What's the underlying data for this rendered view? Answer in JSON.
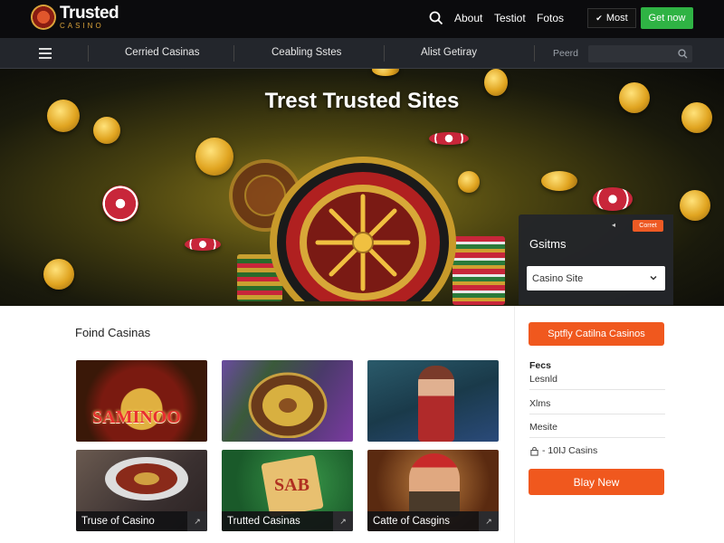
{
  "brand": {
    "name": "Trusted",
    "sub": "CASINO"
  },
  "topnav": {
    "links": [
      "About",
      "Testiot",
      "Fotos"
    ],
    "most_label": "Most",
    "cta_label": "Get now"
  },
  "subnav": {
    "items": [
      "Cerried Casinas",
      "Ceabling Sstes",
      "Alist Getiray"
    ],
    "search_label": "Peerd"
  },
  "hero": {
    "title": "Trest Trusted Sites",
    "card": {
      "badge": "Corret",
      "title": "Gsitms",
      "select_value": "Casino Site"
    }
  },
  "main": {
    "section_title": "Foind Casinas",
    "tiles": [
      {
        "caption": "",
        "image_text": "SAMINOO"
      },
      {
        "caption": ""
      },
      {
        "caption": ""
      },
      {
        "caption": "Truse of Casino"
      },
      {
        "caption": "Trutted Casinas",
        "image_text": "SAB"
      },
      {
        "caption": "Catte of Casgins"
      }
    ]
  },
  "sidebar": {
    "top_button": "Sptfly Catilna Casinos",
    "heading": "Fecs",
    "rows": [
      "Lesnld",
      "Xlms",
      "Mesite",
      "- 10IJ Casins"
    ],
    "bottom_button": "Blay New"
  },
  "colors": {
    "accent": "#f0581e",
    "green": "#2fb344",
    "dark": "#0b0b0d",
    "gold": "#e0a420"
  }
}
